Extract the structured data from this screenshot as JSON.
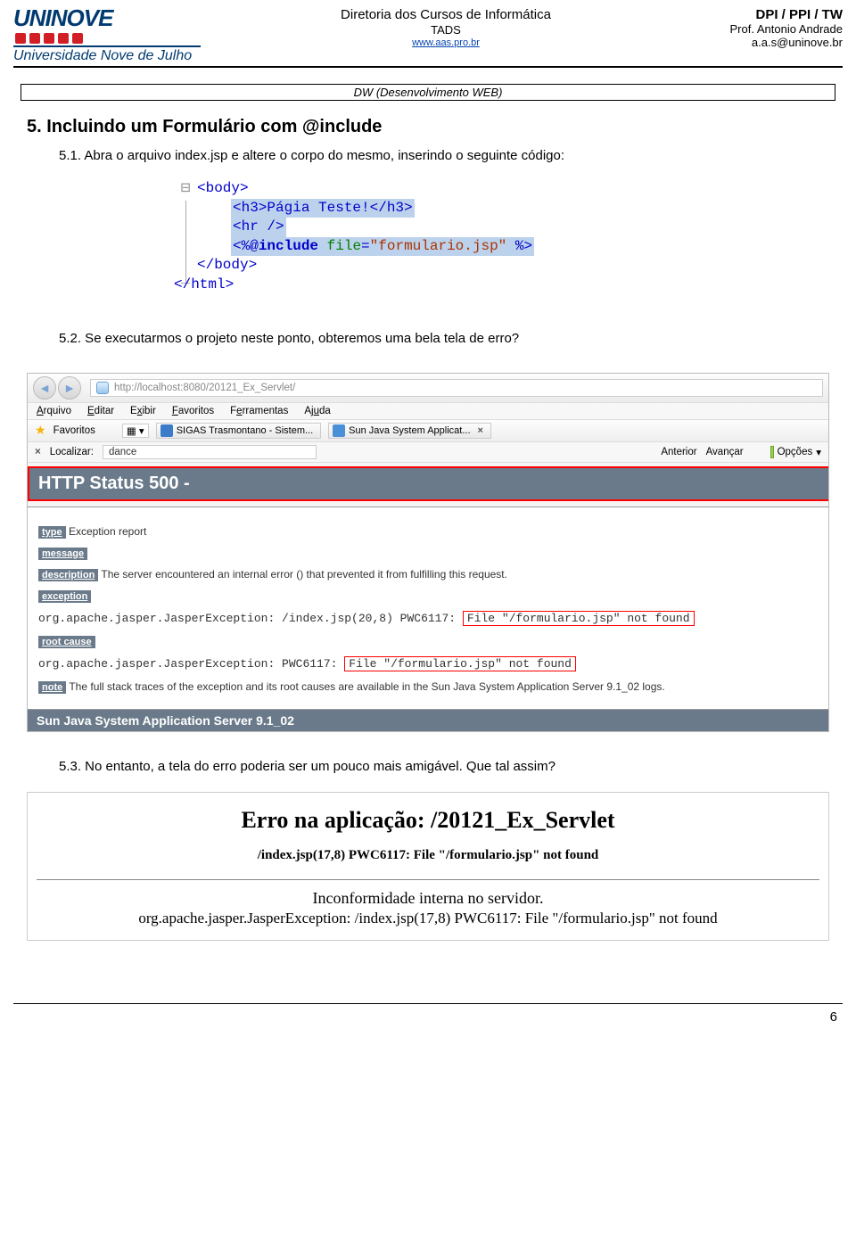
{
  "header": {
    "logo_word": "UNINOVE",
    "logo_sub": "Universidade Nove de Julho",
    "center1": "Diretoria dos Cursos de Informática",
    "center2": "TADS",
    "center3": "www.aas.pro.br",
    "right1": "DPI  / PPI / TW",
    "right2": "Prof. Antonio Andrade",
    "right3": "a.a.s@uninove.br"
  },
  "dw_label": "DW (Desenvolvimento WEB)",
  "sec5_title": "5. Incluindo um Formulário com  @include",
  "p51": "5.1. Abra o arquivo index.jsp e altere o corpo do mesmo, inserindo o seguinte código:",
  "code": {
    "body_open": "<body>",
    "h3": "<h3>Págia Teste!</h3>",
    "hr": "<hr />",
    "inc_open": "<%@",
    "inc_kw": "include",
    "inc_attr": "file",
    "inc_val": "\"formulario.jsp\"",
    "inc_close": "%>",
    "body_close": "</body>",
    "html_close": "</html>"
  },
  "p52": "5.2. Se executarmos o projeto neste ponto, obteremos uma bela tela de erro?",
  "browser": {
    "url": "http://localhost:8080/20121_Ex_Servlet/",
    "menu": {
      "arquivo": "Arquivo",
      "editar": "Editar",
      "exibir": "Exibir",
      "favoritos": "Favoritos",
      "ferramentas": "Ferramentas",
      "ajuda": "Ajuda"
    },
    "fav_label": "Favoritos",
    "tab1": "SIGAS Trasmontano - Sistem...",
    "tab2": "Sun Java System Applicat...",
    "find_label": "Localizar:",
    "find_value": "dance",
    "anterior": "Anterior",
    "avancar": "Avançar",
    "opcoes": "Opções",
    "status_title": "HTTP Status 500 -",
    "type_lbl": "type",
    "type_txt": " Exception report",
    "msg_lbl": "message",
    "desc_lbl": "description",
    "desc_txt": " The server encountered an internal error () that prevented it from fulfilling this request.",
    "exc_lbl": "exception",
    "exc_line_a": "org.apache.jasper.JasperException: /index.jsp(20,8) PWC6117: ",
    "exc_line_b": "File \"/formulario.jsp\" not found",
    "root_lbl": "root cause",
    "root_line_a": "org.apache.jasper.JasperException: PWC6117: ",
    "root_line_b": "File \"/formulario.jsp\" not found",
    "note_lbl": "note",
    "note_txt": " The full stack traces of the exception and its root causes are available in the Sun Java System Application Server 9.1_02 logs.",
    "footer": "Sun Java System Application Server 9.1_02"
  },
  "p53": "5.3. No entanto, a tela do erro poderia ser um pouco mais amigável. Que tal assim?",
  "friendly": {
    "title": "Erro na aplicação: /20121_Ex_Servlet",
    "sub1": "/index.jsp(17,8) PWC6117: File \"/formulario.jsp\" not found",
    "msg": "Inconformidade interna no servidor.",
    "trace": "org.apache.jasper.JasperException: /index.jsp(17,8) PWC6117: File \"/formulario.jsp\" not found"
  },
  "pagenum": "6"
}
